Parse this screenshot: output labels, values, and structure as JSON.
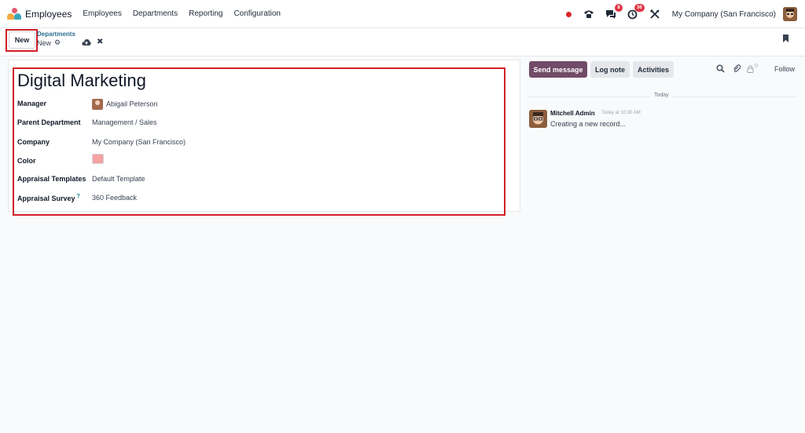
{
  "navbar": {
    "app_name": "Employees",
    "menu": [
      "Employees",
      "Departments",
      "Reporting",
      "Configuration"
    ],
    "messages_badge": "8",
    "activities_badge": "36",
    "company": "My Company (San Francisco)"
  },
  "control_panel": {
    "new_label": "New",
    "breadcrumb": "Departments",
    "record_name": "New"
  },
  "form": {
    "title": "Digital Marketing",
    "fields": {
      "manager": {
        "label": "Manager",
        "value": "Abigail Peterson"
      },
      "parent_department": {
        "label": "Parent Department",
        "value": "Management / Sales"
      },
      "company": {
        "label": "Company",
        "value": "My Company (San Francisco)"
      },
      "color": {
        "label": "Color",
        "value": "#f5a3a3"
      },
      "appraisal_templates": {
        "label": "Appraisal Templates",
        "value": "Default Template"
      },
      "appraisal_survey": {
        "label": "Appraisal Survey",
        "help": "?",
        "value": "360 Feedback"
      }
    }
  },
  "chatter": {
    "send_message": "Send message",
    "log_note": "Log note",
    "activities": "Activities",
    "follower_count": "0",
    "follow": "Follow",
    "date_separator": "Today",
    "message": {
      "author": "Mitchell Admin",
      "time": "Today at 10:30 AM",
      "body": "Creating a new record..."
    }
  },
  "colors": {
    "primary": "#714b67",
    "highlight": "#d21f26",
    "badge": "#dc3545"
  }
}
